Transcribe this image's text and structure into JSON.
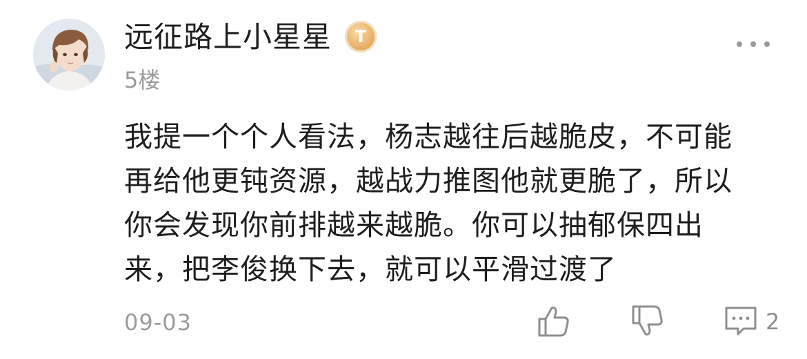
{
  "comment": {
    "username": "远征路上小星星",
    "level_badge": "T",
    "floor": "5楼",
    "content_lines": [
      "我提一个个人看法，杨志越往后越脆皮，不可能",
      "再给他更钝资源，越战力推图他就更脆了，所以",
      "你会发现你前排越来越脆。你可以抽郁保四出",
      "来，把李俊换下去，就可以平滑过渡了"
    ],
    "date": "09-03",
    "reply_count": "2"
  },
  "icons": {
    "more": "more-dots-icon",
    "like": "thumbs-up-icon",
    "dislike": "thumbs-down-icon",
    "reply": "comment-bubble-icon"
  },
  "colors": {
    "badge_gold": "#eab26a",
    "secondary_text": "#9b9b9b",
    "primary_text": "#1e1e1e"
  }
}
